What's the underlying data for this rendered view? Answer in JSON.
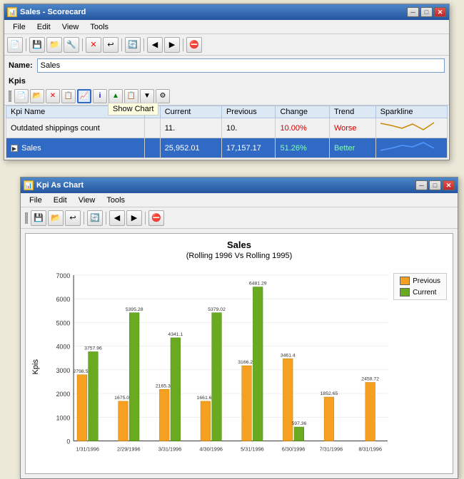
{
  "scorecard_window": {
    "title": "Sales - Scorecard",
    "name_label": "Name:",
    "name_value": "Sales",
    "kpis_label": "Kpis",
    "menus": [
      "File",
      "Edit",
      "View",
      "Tools"
    ],
    "tooltip": "Show Chart",
    "table": {
      "headers": [
        "Kpi Name",
        "",
        "Current",
        "Previous",
        "Change",
        "Trend",
        "Sparkline"
      ],
      "rows": [
        {
          "name": "Outdated shippings count",
          "current": "11.",
          "previous": "10.",
          "change": "10.00%",
          "trend": "Worse",
          "trend_class": "worse",
          "selected": false
        },
        {
          "name": "Sales",
          "current": "25,952.01",
          "previous": "17,157.17",
          "change": "51.26%",
          "trend": "Better",
          "trend_class": "better",
          "selected": true
        }
      ]
    }
  },
  "chart_window": {
    "title": "Kpi As Chart",
    "menus": [
      "File",
      "Edit",
      "View",
      "Tools"
    ],
    "chart_title": "Sales",
    "chart_subtitle": "(Rolling 1996 Vs Rolling 1995)",
    "y_label": "Kpis",
    "y_axis": [
      7000,
      6000,
      5000,
      4000,
      3000,
      2000,
      1000,
      0
    ],
    "x_labels": [
      "1/31/1996",
      "2/29/1996",
      "3/31/1996",
      "4/30/1996",
      "5/31/1996",
      "6/30/1996",
      "7/31/1996",
      "8/31/1996"
    ],
    "legend": {
      "previous_label": "Previous",
      "current_label": "Current",
      "previous_color": "#f5a020",
      "current_color": "#6aaa20"
    },
    "bars": [
      {
        "label": "1/31/1996",
        "previous": 2798.59,
        "current": 3757.96
      },
      {
        "label": "2/29/1996",
        "previous": 1675.06,
        "current": 5395.28
      },
      {
        "label": "3/31/1996",
        "previous": 2165.37,
        "current": 4341.1
      },
      {
        "label": "4/30/1996",
        "previous": 1661.66,
        "current": 5379.02
      },
      {
        "label": "5/31/1996",
        "previous": 3166.25,
        "current": 6481.29
      },
      {
        "label": "6/30/1996",
        "previous": 3461.4,
        "current": 597.36
      },
      {
        "label": "7/31/1996",
        "previous": 1852.65,
        "current": null
      },
      {
        "label": "8/31/1996",
        "previous": 2458.72,
        "current": null
      }
    ]
  }
}
